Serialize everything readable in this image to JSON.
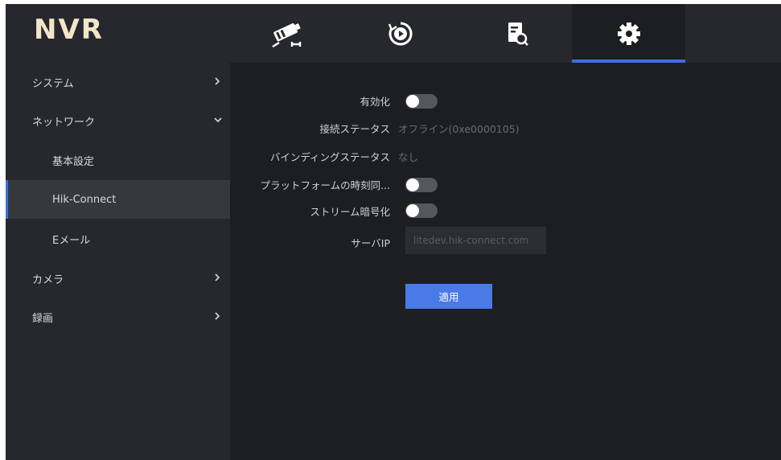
{
  "app": {
    "title": "NVR"
  },
  "top_tabs": [
    {
      "name": "live-view",
      "icon": "camera-icon",
      "active": false
    },
    {
      "name": "playback",
      "icon": "playback-icon",
      "active": false
    },
    {
      "name": "search",
      "icon": "file-search-icon",
      "active": false
    },
    {
      "name": "settings",
      "icon": "gear-icon",
      "active": true
    }
  ],
  "sidebar": {
    "items": [
      {
        "label": "システム",
        "expandable": true
      },
      {
        "label": "ネットワーク",
        "expandable": true,
        "expanded": true
      },
      {
        "label": "基本設定"
      },
      {
        "label": "Hik-Connect",
        "active": true
      },
      {
        "label": "Eメール"
      },
      {
        "label": "カメラ",
        "expandable": true
      },
      {
        "label": "録画",
        "expandable": true
      }
    ]
  },
  "form": {
    "enable": {
      "label": "有効化",
      "on": false
    },
    "connection_status": {
      "label": "接続ステータス",
      "value": "オフライン(0xe0000105)"
    },
    "binding_status": {
      "label": "バインディングステータス",
      "value": "なし"
    },
    "platform_time_sync": {
      "label": "プラットフォームの時刻同...",
      "on": false
    },
    "stream_encryption": {
      "label": "ストリーム暗号化",
      "on": false
    },
    "server_ip": {
      "label": "サーバIP",
      "placeholder": "litedev.hik-connect.com"
    },
    "apply_label": "適用"
  },
  "colors": {
    "accent": "#3f6fe0",
    "button": "#4a7ae6",
    "background": "#1d1e22",
    "panel": "#27282d"
  }
}
